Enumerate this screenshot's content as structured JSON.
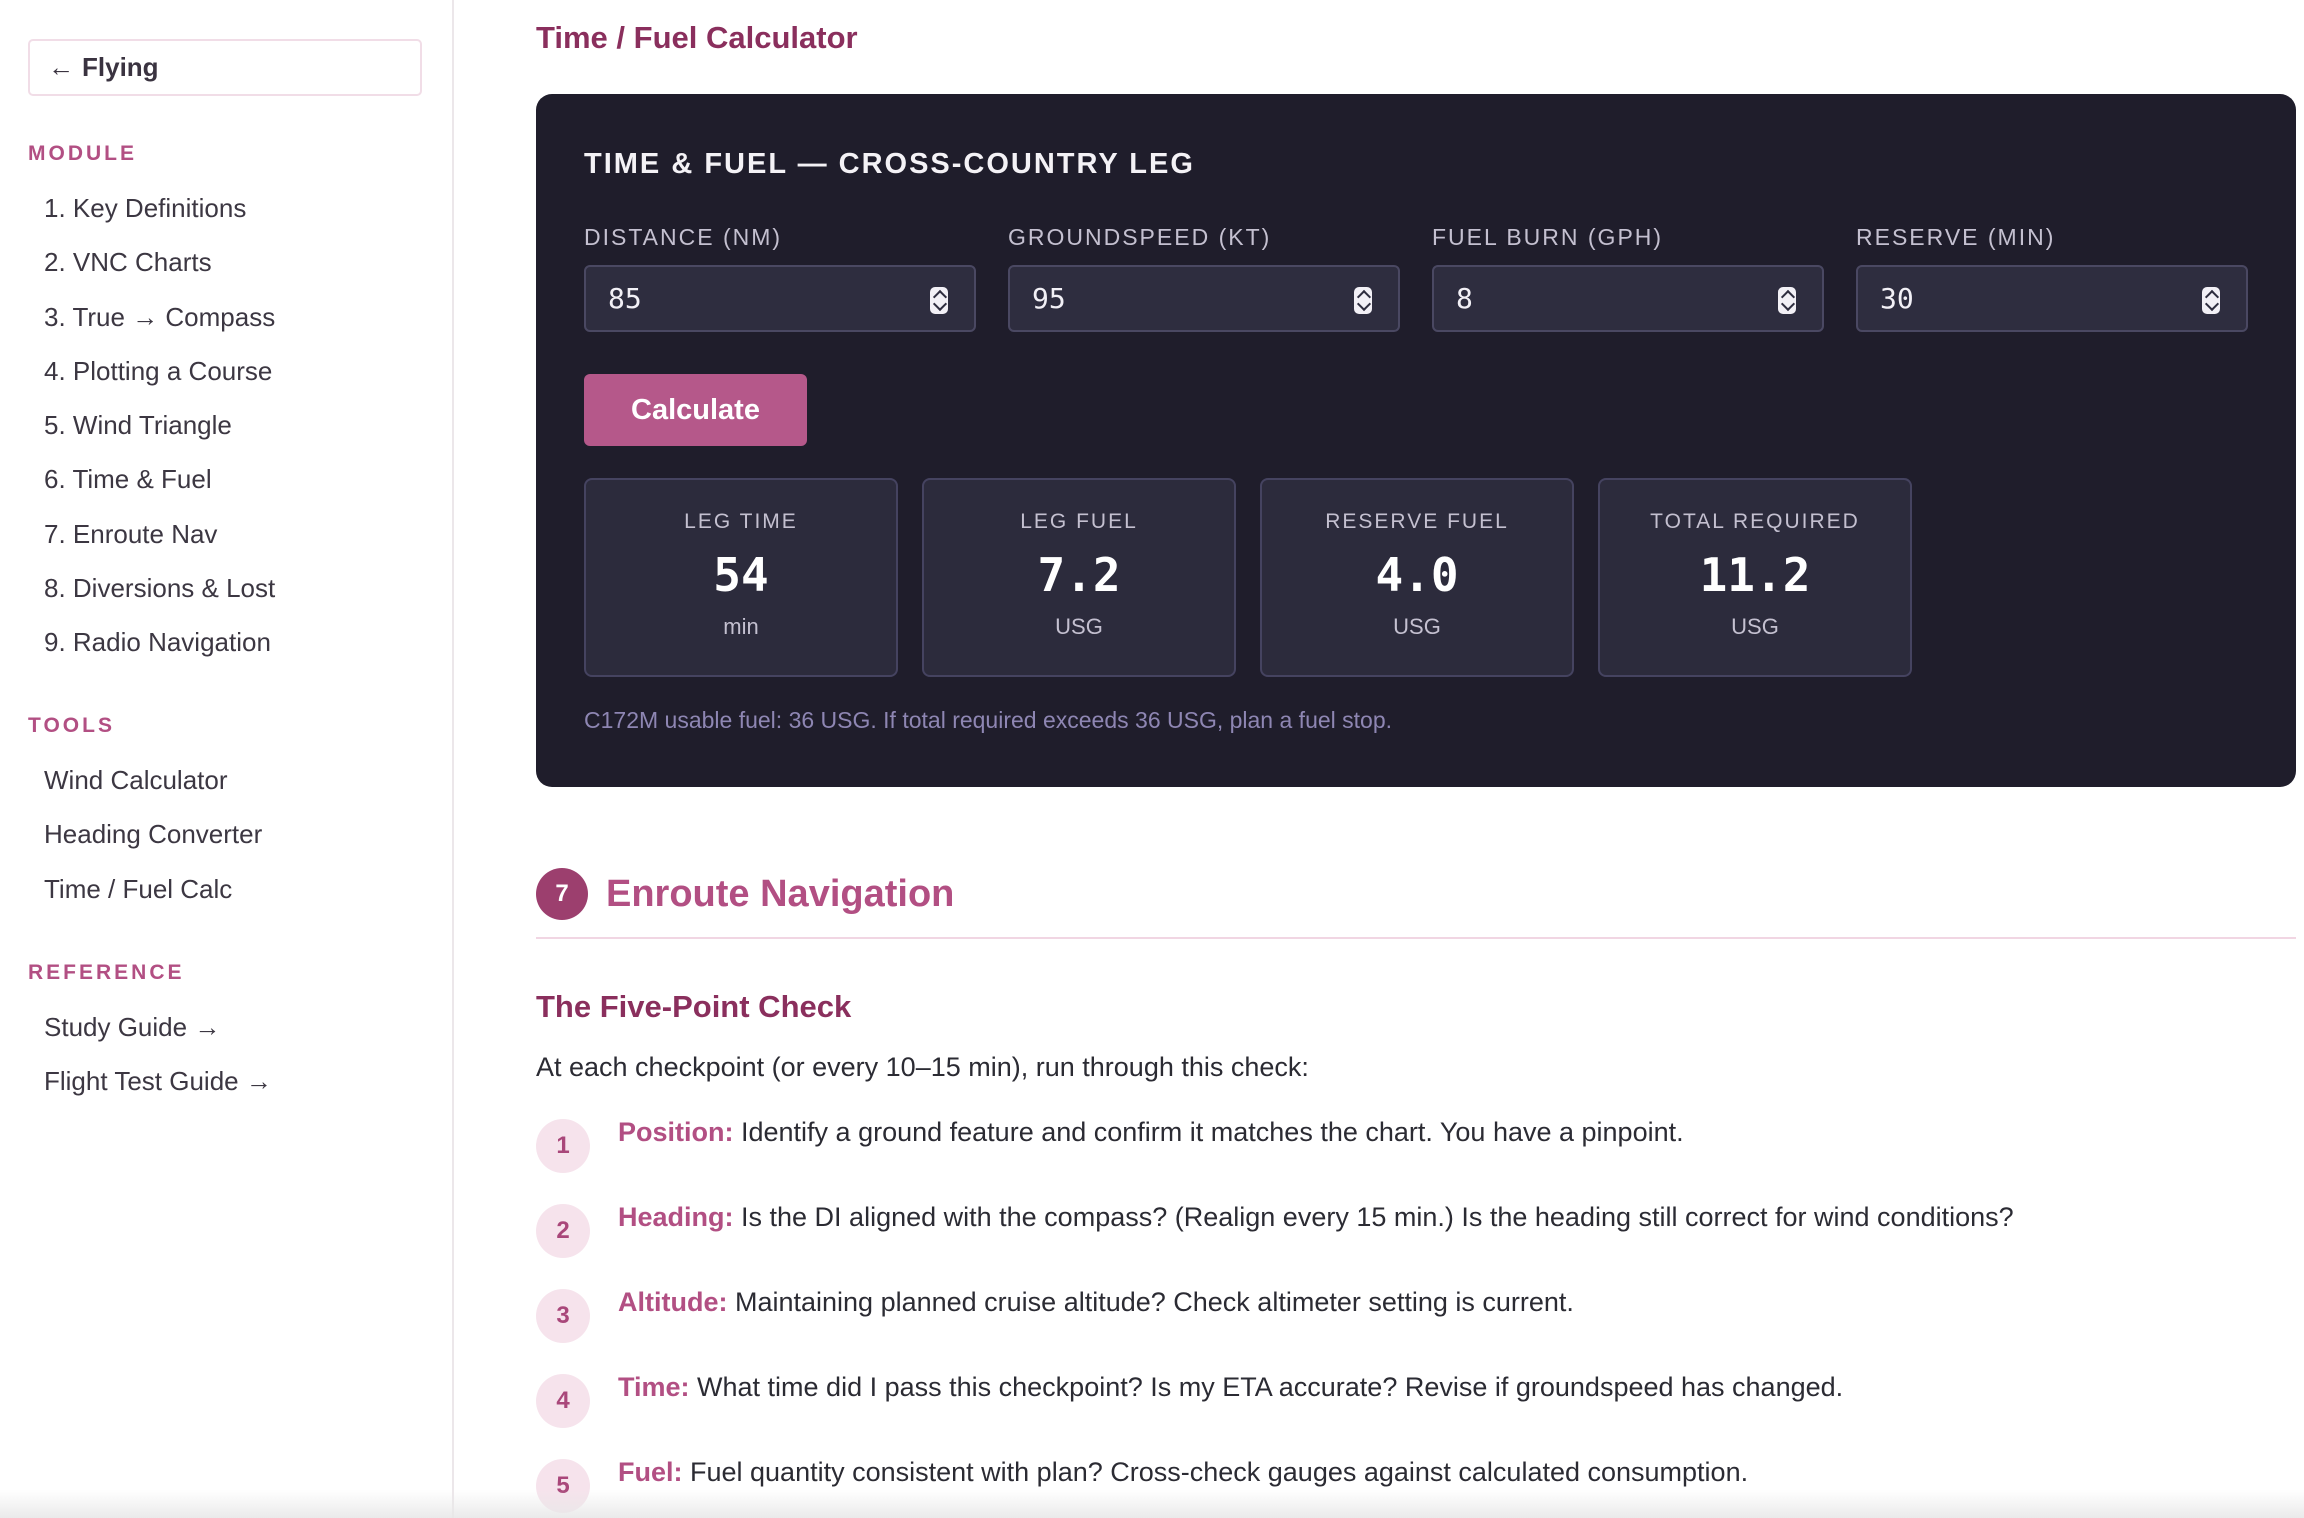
{
  "sidebar": {
    "back_label": "Flying",
    "module_heading": "MODULE",
    "module_items": [
      "1. Key Definitions",
      "2. VNC Charts",
      "3. True → Compass",
      "4. Plotting a Course",
      "5. Wind Triangle",
      "6. Time & Fuel",
      "7. Enroute Nav",
      "8. Diversions & Lost",
      "9. Radio Navigation"
    ],
    "tools_heading": "TOOLS",
    "tools_items": [
      "Wind Calculator",
      "Heading Converter",
      "Time / Fuel Calc"
    ],
    "reference_heading": "REFERENCE",
    "reference_items": [
      "Study Guide →",
      "Flight Test Guide →"
    ]
  },
  "calculator": {
    "page_title": "Time / Fuel Calculator",
    "card_title": "TIME & FUEL — CROSS-COUNTRY LEG",
    "fields": [
      {
        "label": "DISTANCE (NM)",
        "value": "85"
      },
      {
        "label": "GROUNDSPEED (KT)",
        "value": "95"
      },
      {
        "label": "FUEL BURN (GPH)",
        "value": "8"
      },
      {
        "label": "RESERVE (MIN)",
        "value": "30"
      }
    ],
    "button_label": "Calculate",
    "results": [
      {
        "label": "LEG TIME",
        "value": "54",
        "unit": "min"
      },
      {
        "label": "LEG FUEL",
        "value": "7.2",
        "unit": "USG"
      },
      {
        "label": "RESERVE FUEL",
        "value": "4.0",
        "unit": "USG"
      },
      {
        "label": "TOTAL REQUIRED",
        "value": "11.2",
        "unit": "USG"
      }
    ],
    "note": "C172M usable fuel: 36 USG. If total required exceeds 36 USG, plan a fuel stop."
  },
  "section": {
    "number": "7",
    "title": "Enroute Navigation",
    "subtitle": "The Five-Point Check",
    "intro": "At each checkpoint (or every 10–15 min), run through this check:",
    "checks": [
      {
        "num": "1",
        "term": "Position:",
        "text": " Identify a ground feature and confirm it matches the chart. You have a pinpoint."
      },
      {
        "num": "2",
        "term": "Heading:",
        "text": " Is the DI aligned with the compass? (Realign every 15 min.) Is the heading still correct for wind conditions?"
      },
      {
        "num": "3",
        "term": "Altitude:",
        "text": " Maintaining planned cruise altitude? Check altimeter setting is current."
      },
      {
        "num": "4",
        "term": "Time:",
        "text": " What time did I pass this checkpoint? Is my ETA accurate? Revise if groundspeed has changed."
      },
      {
        "num": "5",
        "term": "Fuel:",
        "text": " Fuel quantity consistent with plan? Cross-check gauges against calculated consumption."
      }
    ]
  },
  "colors": {
    "accent": "#b24f83",
    "accent_dark": "#8a2f5d",
    "card_bg": "#1f1d2b",
    "button": "#b5588a"
  },
  "icons": {
    "back": "arrow-left-icon",
    "spinner": "number-spinner-icon"
  }
}
